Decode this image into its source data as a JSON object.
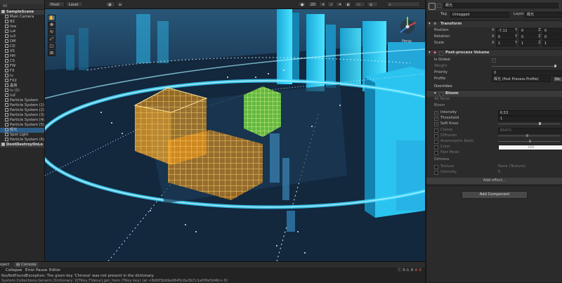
{
  "hierarchy": {
    "search_label": "All",
    "items": [
      {
        "label": "SampleScene",
        "kind": "scene",
        "indent": 0
      },
      {
        "label": "Main Camera",
        "indent": 1
      },
      {
        "label": "BZ",
        "indent": 1
      },
      {
        "label": "line",
        "indent": 1
      },
      {
        "label": "lu4",
        "indent": 1
      },
      {
        "label": "lu3",
        "indent": 1
      },
      {
        "label": "DM",
        "indent": 1
      },
      {
        "label": "CD",
        "indent": 1
      },
      {
        "label": "XS",
        "indent": 1
      },
      {
        "label": "HH",
        "indent": 1
      },
      {
        "label": "CS",
        "indent": 1
      },
      {
        "label": "FW",
        "indent": 1
      },
      {
        "label": "FX",
        "indent": 1
      },
      {
        "label": "lu",
        "indent": 1
      },
      {
        "label": "FX2",
        "indent": 1
      },
      {
        "label": "晶格",
        "indent": 1
      },
      {
        "label": "lu (1)",
        "indent": 1
      },
      {
        "label": "lu2",
        "indent": 1
      },
      {
        "label": "Particle System",
        "indent": 1
      },
      {
        "label": "Particle System (1)",
        "indent": 1
      },
      {
        "label": "Particle System (2)",
        "indent": 1
      },
      {
        "label": "Particle System (3)",
        "indent": 1
      },
      {
        "label": "Particle System (4)",
        "indent": 1
      },
      {
        "label": "Particle System (5)",
        "indent": 1
      },
      {
        "label": "辉光",
        "indent": 1,
        "selected": true
      },
      {
        "label": "Spot Light",
        "indent": 1
      },
      {
        "label": "Particle System (6)",
        "indent": 1
      },
      {
        "label": "DontDestroyOnLo",
        "kind": "scene",
        "indent": 0
      }
    ]
  },
  "scene_toolbar": {
    "pivot": "Pivot",
    "space": "Local",
    "mode_2d": "2D",
    "persp_label": "Persp"
  },
  "tools": [
    "hand",
    "move",
    "rotate",
    "scale",
    "rect",
    "transform"
  ],
  "inspector": {
    "object_name": "辉光",
    "tag_label": "Tag",
    "tag_value": "Untagged",
    "layer_label": "Layer",
    "layer_value": "辉光",
    "transform": {
      "title": "Transform",
      "rows": [
        {
          "label": "Position",
          "x": "-7.11",
          "y": "0",
          "z": "0"
        },
        {
          "label": "Rotation",
          "x": "0",
          "y": "0",
          "z": "0"
        },
        {
          "label": "Scale",
          "x": "1",
          "y": "1",
          "z": "1"
        }
      ]
    },
    "ppv": {
      "title": "Post-process Volume",
      "is_global": "Is Global",
      "weight": "Weight",
      "priority": "Priority",
      "priority_value": "0",
      "profile": "Profile",
      "profile_value": "辉光 (Post Process Profile)",
      "new_button": "Ne"
    },
    "overrides": "Overrides",
    "bloom": {
      "title": "Bloom",
      "all_none": "All  None",
      "section": "Bloom",
      "intensity": "Intensity",
      "intensity_value": "6.53",
      "threshold": "Threshold",
      "threshold_value": "1",
      "soft_knee": "Soft Knee",
      "clamp": "Clamp",
      "clamp_value": "65472",
      "diffusion": "Diffusion",
      "anamorphic": "Anamorphic Ratio",
      "color": "Color",
      "color_tag": "HDR",
      "fast_mode": "Fast Mode"
    },
    "dirtiness": {
      "section": "Dirtiness",
      "texture": "Texture",
      "texture_value": "None (Texture)",
      "intensity": "Intensity",
      "intensity_value": "0"
    },
    "add_effect": "Add effect...",
    "add_component": "Add Component"
  },
  "console": {
    "tab_project": "oject",
    "tab_console": "Console",
    "clear": "Clear",
    "collapse": "Collapse",
    "error_pause": "Error Pause",
    "editor": "Editor",
    "count_a": "0",
    "count_b": "0",
    "count_c": "0",
    "line1": "KeyNotFoundException: The given key 'Chinese' was not present in the dictionary.",
    "line2": "System.Collections.Generic.Dictionary`2[TKey,TValue].get_Item (TKey key) (at <8d0f3bb9a9645c6a3b7c1a0f6e5d4b>:0)"
  },
  "colors": {
    "scene_bg": "#0e1f33",
    "cyan_glow": "#3fd8ff",
    "orange_glow": "#ffa21a",
    "green_glow": "#8dff3a",
    "selection": "#2c5d87"
  }
}
